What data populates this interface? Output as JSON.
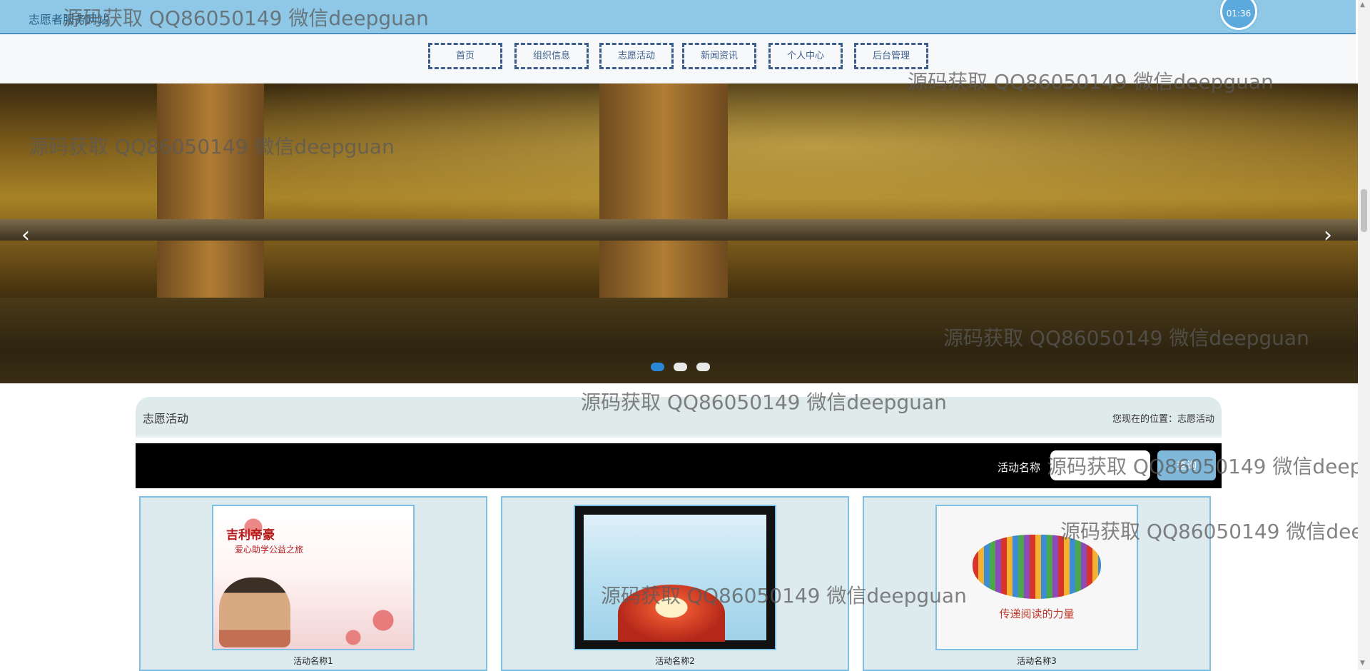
{
  "header": {
    "site_title": "志愿者服务网站",
    "clock": "01:36"
  },
  "nav": {
    "items": [
      {
        "label": "首页"
      },
      {
        "label": "组织信息"
      },
      {
        "label": "志愿活动"
      },
      {
        "label": "新闻资讯"
      },
      {
        "label": "个人中心"
      },
      {
        "label": "后台管理"
      }
    ]
  },
  "banner": {
    "prev_icon": "‹",
    "next_icon": "›",
    "slides": 3,
    "active_slide": 1
  },
  "section": {
    "title": "志愿活动",
    "location": "您现在的位置：志愿活动"
  },
  "search": {
    "label": "活动名称",
    "placeholder": "",
    "button": "查询"
  },
  "cards": [
    {
      "name": "活动名称1",
      "img_title": "吉利帝豪",
      "img_sub": "爱心助学公益之旅"
    },
    {
      "name": "活动名称2"
    },
    {
      "name": "活动名称3",
      "img_caption": "传递阅读的力量"
    }
  ],
  "watermark": "源码获取 QQ86050149 微信deepguan",
  "colors": {
    "topbar": "#8ec8e6",
    "nav_border": "#3d5f8f",
    "card_bg": "#deebee",
    "card_border": "#7ec0e2",
    "search_bar": "#000000",
    "search_button": "#7fb8d8"
  }
}
